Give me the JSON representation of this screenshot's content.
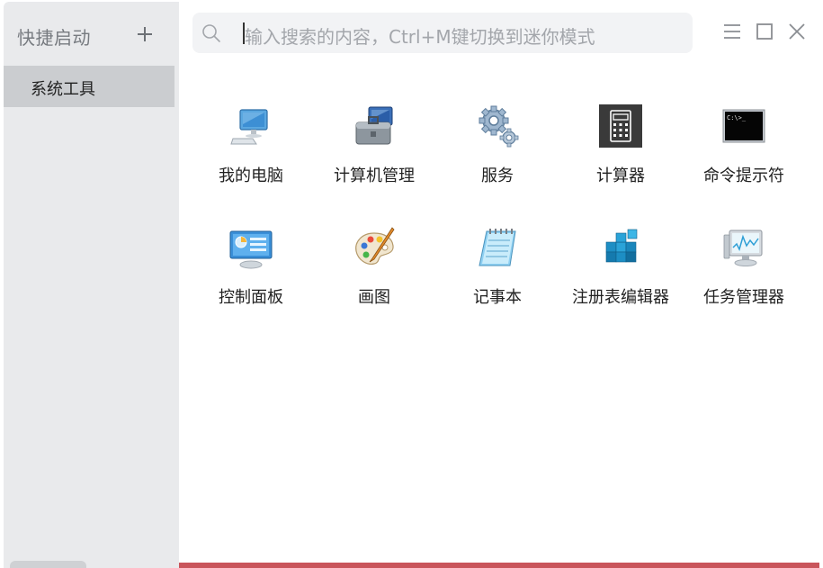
{
  "sidebar": {
    "title": "快捷启动",
    "add_icon": "plus-icon",
    "items": [
      {
        "label": "系统工具"
      }
    ]
  },
  "search": {
    "placeholder": "输入搜索的内容，Ctrl+M键切换到迷你模式",
    "icon": "search-icon"
  },
  "window_controls": [
    "menu-icon",
    "maximize-icon",
    "close-icon"
  ],
  "apps": [
    {
      "label": "我的电脑",
      "icon": "computer-icon"
    },
    {
      "label": "计算机管理",
      "icon": "computer-management-icon"
    },
    {
      "label": "服务",
      "icon": "gears-icon"
    },
    {
      "label": "计算器",
      "icon": "calculator-icon"
    },
    {
      "label": "命令提示符",
      "icon": "command-prompt-icon"
    },
    {
      "label": "控制面板",
      "icon": "control-panel-icon"
    },
    {
      "label": "画图",
      "icon": "paint-palette-icon"
    },
    {
      "label": "记事本",
      "icon": "notepad-icon"
    },
    {
      "label": "注册表编辑器",
      "icon": "registry-editor-icon"
    },
    {
      "label": "任务管理器",
      "icon": "task-manager-icon"
    }
  ],
  "cmd_prompt_text": "C:\\>_",
  "colors": {
    "sidebar_bg": "#e9eaec",
    "selected_item_bg": "#cbcdd0",
    "search_bg": "#f2f3f5",
    "accent_bar": "#c9555b"
  }
}
